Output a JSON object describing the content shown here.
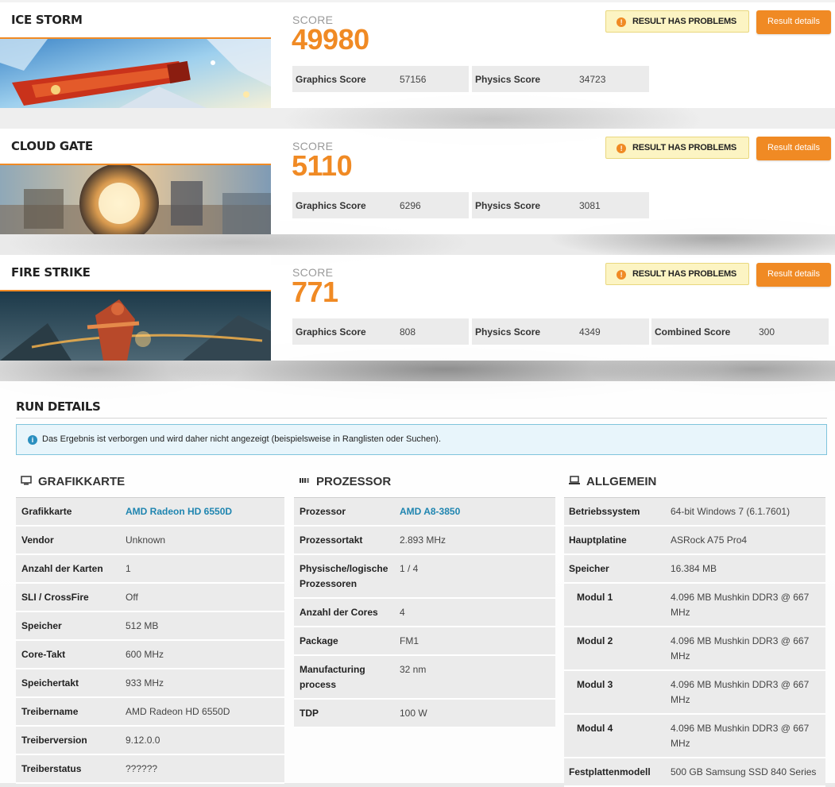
{
  "benchmarks": [
    {
      "name": "ICE STORM",
      "score_label": "SCORE",
      "score": "49980",
      "problem_label": "RESULT HAS PROBLEMS",
      "details_label": "Result details",
      "subscores": [
        {
          "label": "Graphics Score",
          "value": "57156"
        },
        {
          "label": "Physics Score",
          "value": "34723"
        }
      ]
    },
    {
      "name": "CLOUD GATE",
      "score_label": "SCORE",
      "score": "5110",
      "problem_label": "RESULT HAS PROBLEMS",
      "details_label": "Result details",
      "subscores": [
        {
          "label": "Graphics Score",
          "value": "6296"
        },
        {
          "label": "Physics Score",
          "value": "3081"
        }
      ]
    },
    {
      "name": "FIRE STRIKE",
      "score_label": "SCORE",
      "score": "771",
      "problem_label": "RESULT HAS PROBLEMS",
      "details_label": "Result details",
      "subscores": [
        {
          "label": "Graphics Score",
          "value": "808"
        },
        {
          "label": "Physics Score",
          "value": "4349"
        },
        {
          "label": "Combined Score",
          "value": "300"
        }
      ]
    }
  ],
  "run_details": {
    "title": "RUN DETAILS",
    "notice": "Das Ergebnis ist verborgen und wird daher nicht angezeigt (beispielsweise in Ranglisten oder Suchen).",
    "gpu": {
      "heading": "GRAFIKKARTE",
      "rows": [
        {
          "key": "Grafikkarte",
          "value": "AMD Radeon HD 6550D"
        },
        {
          "key": "Vendor",
          "value": "Unknown"
        },
        {
          "key": "Anzahl der Karten",
          "value": "1"
        },
        {
          "key": "SLI / CrossFire",
          "value": "Off"
        },
        {
          "key": "Speicher",
          "value": "512 MB"
        },
        {
          "key": "Core-Takt",
          "value": "600 MHz"
        },
        {
          "key": "Speichertakt",
          "value": "933 MHz"
        },
        {
          "key": "Treibername",
          "value": "AMD Radeon HD 6550D"
        },
        {
          "key": "Treiberversion",
          "value": "9.12.0.0"
        },
        {
          "key": "Treiberstatus",
          "value": "??????"
        }
      ]
    },
    "cpu": {
      "heading": "PROZESSOR",
      "rows": [
        {
          "key": "Prozessor",
          "value": "AMD A8-3850"
        },
        {
          "key": "Prozessortakt",
          "value": "2.893 MHz"
        },
        {
          "key_line1": "Physische/logische",
          "key_line2": "Prozessoren",
          "value": "1 / 4"
        },
        {
          "key": "Anzahl der Cores",
          "value": "4"
        },
        {
          "key": "Package",
          "value": "FM1"
        },
        {
          "key_line1": "Manufacturing",
          "key_line2": "process",
          "value": "32 nm"
        },
        {
          "key": "TDP",
          "value": "100 W"
        }
      ]
    },
    "general": {
      "heading": "ALLGEMEIN",
      "rows": [
        {
          "key": "Betriebssystem",
          "value": "64-bit Windows 7 (6.1.7601)"
        },
        {
          "key": "Hauptplatine",
          "value": "ASRock A75 Pro4"
        },
        {
          "key": "Speicher",
          "value": "16.384 MB"
        },
        {
          "key": "Modul 1",
          "value_line1": "4.096 MB Mushkin DDR3 @ 667",
          "value_line2": "MHz"
        },
        {
          "key": "Modul 2",
          "value_line1": "4.096 MB Mushkin DDR3 @ 667",
          "value_line2": "MHz"
        },
        {
          "key": "Modul 3",
          "value_line1": "4.096 MB Mushkin DDR3 @ 667",
          "value_line2": "MHz"
        },
        {
          "key": "Modul 4",
          "value_line1": "4.096 MB Mushkin DDR3 @ 667",
          "value_line2": "MHz"
        },
        {
          "key": "Festplattenmodell",
          "value": "500 GB Samsung SSD 840 Series"
        }
      ]
    }
  },
  "colors": {
    "accent": "#f08a24",
    "link": "#1f85b0",
    "warning_bg": "#fcf4c3",
    "info_bg": "#e8f5fb"
  },
  "icons": [
    "warning-icon",
    "info-icon",
    "monitor-icon",
    "cpu-icon",
    "laptop-icon"
  ]
}
